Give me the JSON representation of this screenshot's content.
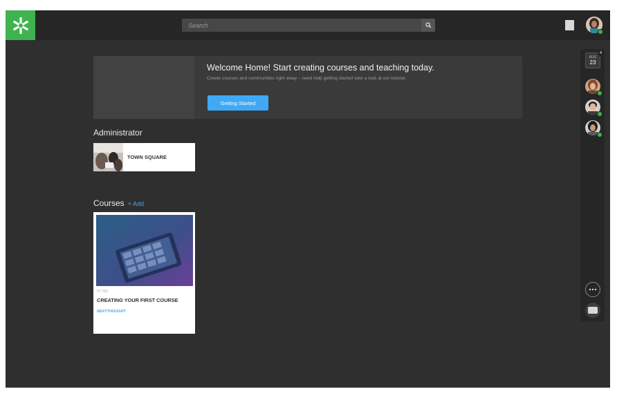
{
  "header": {
    "search_placeholder": "Search",
    "logo_icon": "nextthought-asterisk-logo",
    "search_icon": "magnifier-icon",
    "notification_icon": "notification-square-icon"
  },
  "welcome": {
    "title": "Welcome Home! Start creating courses and teaching today.",
    "subtitle": "Create courses and communities right away – need help getting started take a look at our tutorial.",
    "button_label": "Getting Started"
  },
  "administrator": {
    "heading": "Administrator",
    "community_name": "TOWN SQUARE"
  },
  "courses": {
    "heading": "Courses",
    "add_label": "+ Add",
    "items": [
      {
        "code": "NT 001",
        "title": "CREATING YOUR FIRST COURSE",
        "author": "NEXTTHOUGHT"
      }
    ]
  },
  "rail": {
    "calendar_month": "AUG",
    "calendar_day": "23",
    "notification_count": "4",
    "more_icon": "ellipsis-icon",
    "chat_icon": "chat-bubble-icon"
  },
  "colors": {
    "accent": "#3fa9f5",
    "brand": "#3fb34f",
    "background": "#2f2f2f",
    "topbar": "#262626"
  }
}
